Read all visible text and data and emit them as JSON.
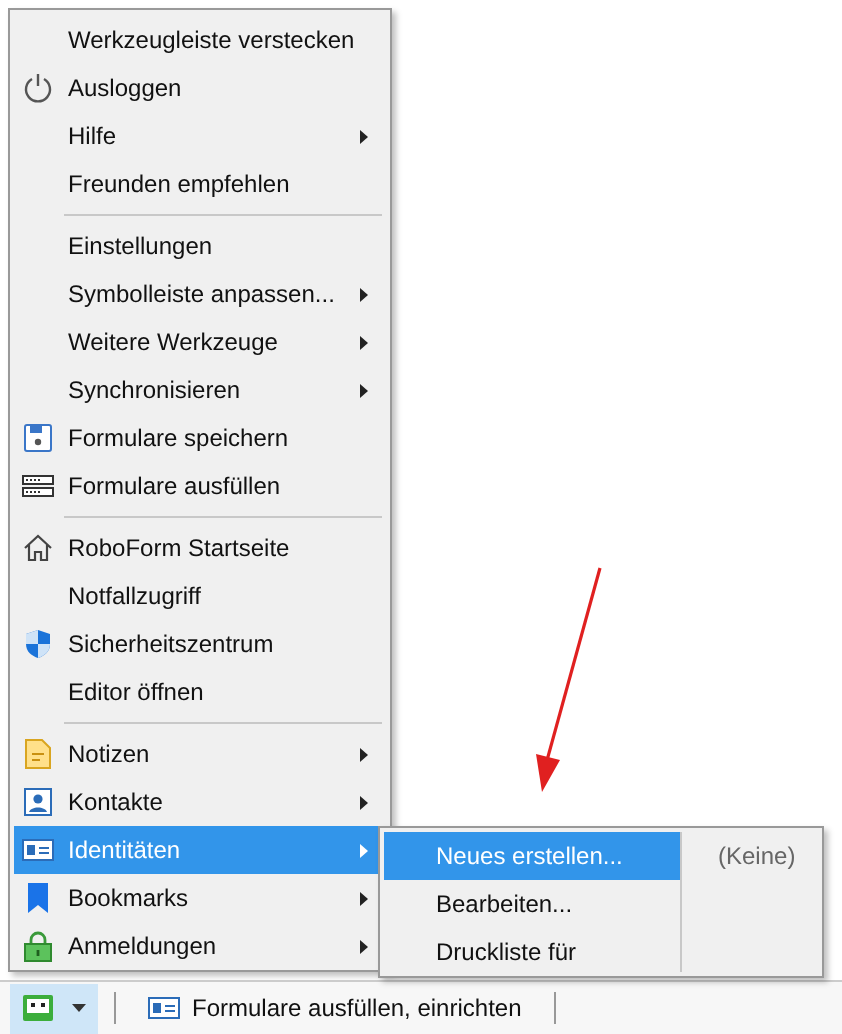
{
  "menu": {
    "sections": [
      [
        {
          "label": "Werkzeugleiste verstecken",
          "kind": "plain",
          "submenu": false,
          "selected": false
        },
        {
          "label": "Ausloggen",
          "kind": "power",
          "submenu": false,
          "selected": false
        },
        {
          "label": "Hilfe",
          "kind": "plain",
          "submenu": true,
          "selected": false
        },
        {
          "label": "Freunden empfehlen",
          "kind": "plain",
          "submenu": false,
          "selected": false
        }
      ],
      [
        {
          "label": "Einstellungen",
          "kind": "plain",
          "submenu": false,
          "selected": false
        },
        {
          "label": "Symbolleiste anpassen...",
          "kind": "plain",
          "submenu": true,
          "selected": false
        },
        {
          "label": "Weitere Werkzeuge",
          "kind": "plain",
          "submenu": true,
          "selected": false
        },
        {
          "label": "Synchronisieren",
          "kind": "plain",
          "submenu": true,
          "selected": false
        },
        {
          "label": "Formulare speichern",
          "kind": "save",
          "submenu": false,
          "selected": false
        },
        {
          "label": "Formulare ausfüllen",
          "kind": "fill",
          "submenu": false,
          "selected": false
        }
      ],
      [
        {
          "label": "RoboForm Startseite",
          "kind": "home",
          "submenu": false,
          "selected": false
        },
        {
          "label": "Notfallzugriff",
          "kind": "plain",
          "submenu": false,
          "selected": false
        },
        {
          "label": "Sicherheitszentrum",
          "kind": "shield",
          "submenu": false,
          "selected": false
        },
        {
          "label": "Editor öffnen",
          "kind": "plain",
          "submenu": false,
          "selected": false
        }
      ],
      [
        {
          "label": "Notizen",
          "kind": "note",
          "submenu": true,
          "selected": false
        },
        {
          "label": "Kontakte",
          "kind": "contact",
          "submenu": true,
          "selected": false
        },
        {
          "label": "Identitäten",
          "kind": "id",
          "submenu": true,
          "selected": true
        },
        {
          "label": "Bookmarks",
          "kind": "bookmark",
          "submenu": true,
          "selected": false
        },
        {
          "label": "Anmeldungen",
          "kind": "lock",
          "submenu": true,
          "selected": false
        }
      ]
    ]
  },
  "submenu": {
    "items": [
      {
        "label": "Neues erstellen...",
        "selected": true
      },
      {
        "label": "Bearbeiten...",
        "selected": false
      },
      {
        "label": "Druckliste für",
        "selected": false
      }
    ],
    "side_text": "(Keine)"
  },
  "toolbar": {
    "robot_button_pressed": true,
    "fill_button": "Formulare ausfüllen, einrichten"
  }
}
